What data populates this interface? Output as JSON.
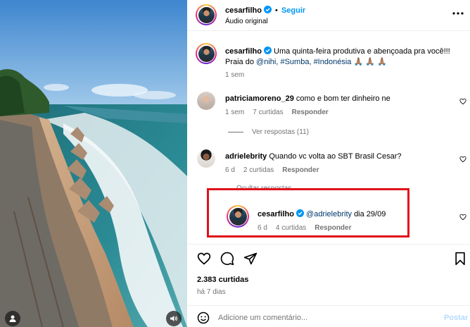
{
  "post": {
    "username": "cesarfilho",
    "follow_label": "Seguir",
    "audio": "Áudio original"
  },
  "caption": {
    "username": "cesarfilho",
    "text_1": "Uma quinta-feira produtiva e abençoada pra você!!!",
    "text_2": "Praia do",
    "mention": "@nihi,",
    "tag1": "#Sumba,",
    "tag2": "#Indonésia",
    "emojis": "🙏🏽 🙏🏽 🙏🏽",
    "time": "1 sem"
  },
  "comments": [
    {
      "username": "patriciamoreno_29",
      "text": "como e bom ter dinheiro ne",
      "time": "1 sem",
      "likes": "7 curtidas",
      "reply": "Responder",
      "view_replies": "Ver respostas (11)"
    },
    {
      "username": "adrielebrity",
      "text": "Quando vc volta ao SBT Brasil Cesar?",
      "time": "6 d",
      "likes": "2 curtidas",
      "reply": "Responder",
      "hide_replies": "Ocultar respostas"
    }
  ],
  "reply": {
    "username": "cesarfilho",
    "mention": "@adrielebrity",
    "text": "dia 29/09",
    "time": "6 d",
    "likes": "4 curtidas",
    "reply": "Responder"
  },
  "stats": {
    "likes": "2.383 curtidas",
    "date": "há 7 dias"
  },
  "comment_box": {
    "placeholder": "Adicione um comentário...",
    "post_label": "Postar"
  },
  "icons": {
    "verified": "verified-badge-icon",
    "like": "heart-icon",
    "comment": "comment-bubble-icon",
    "share": "paper-plane-icon",
    "save": "bookmark-icon",
    "emoji": "smiley-icon",
    "user": "user-tag-icon",
    "sound": "speaker-icon"
  },
  "colors": {
    "link": "#00376b",
    "follow": "#0095f6",
    "highlight": "#e0101a",
    "verified": "#0095f6"
  }
}
